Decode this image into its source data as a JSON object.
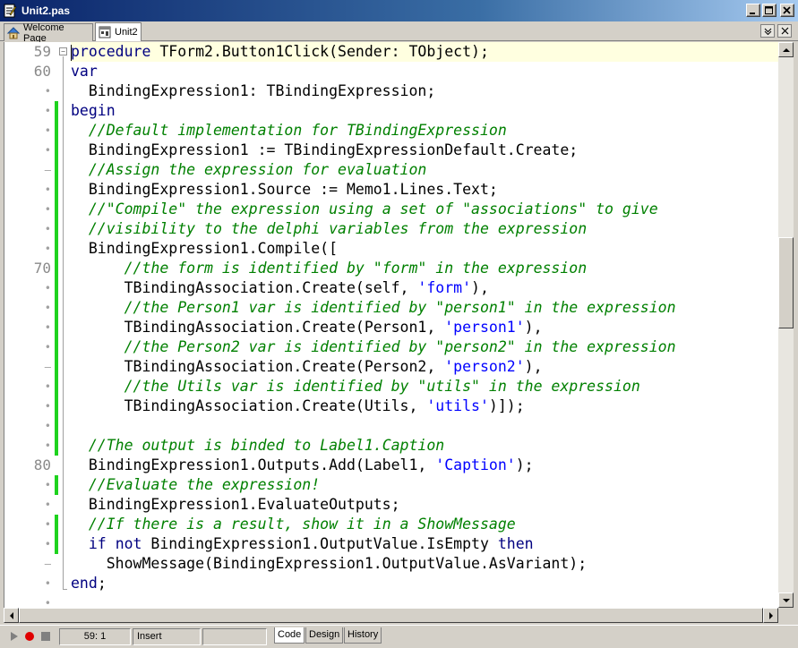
{
  "window": {
    "title": "Unit2.pas"
  },
  "tabs": [
    {
      "label": "Welcome Page"
    },
    {
      "label": "Unit2"
    }
  ],
  "gutter": [
    "59",
    "60",
    "•",
    "•",
    "•",
    "•",
    "–",
    "•",
    "•",
    "•",
    "•",
    "70",
    "•",
    "•",
    "•",
    "•",
    "–",
    "•",
    "•",
    "•",
    "•",
    "80",
    "•",
    "•",
    "•",
    "•",
    "–",
    "•",
    "•"
  ],
  "code": [
    "procedure TForm2.Button1Click(Sender: TObject);",
    "var",
    "  BindingExpression1: TBindingExpression;",
    "begin",
    "  //Default implementation for TBindingExpression",
    "  BindingExpression1 := TBindingExpressionDefault.Create;",
    "  //Assign the expression for evaluation",
    "  BindingExpression1.Source := Memo1.Lines.Text;",
    "  //\"Compile\" the expression using a set of \"associations\" to give",
    "  //visibility to the delphi variables from the expression",
    "  BindingExpression1.Compile([",
    "      //the form is identified by \"form\" in the expression",
    "      TBindingAssociation.Create(self, 'form'),",
    "      //the Person1 var is identified by \"person1\" in the expression",
    "      TBindingAssociation.Create(Person1, 'person1'),",
    "      //the Person2 var is identified by \"person2\" in the expression",
    "      TBindingAssociation.Create(Person2, 'person2'),",
    "      //the Utils var is identified by \"utils\" in the expression",
    "      TBindingAssociation.Create(Utils, 'utils')]);",
    "",
    "  //The output is binded to Label1.Caption",
    "  BindingExpression1.Outputs.Add(Label1, 'Caption');",
    "  //Evaluate the expression!",
    "  BindingExpression1.EvaluateOutputs;",
    "  //If there is a result, show it in a ShowMessage",
    "  if not BindingExpression1.OutputValue.IsEmpty then",
    "    ShowMessage(BindingExpression1.OutputValue.AsVariant);",
    "end;",
    ""
  ],
  "status": {
    "position": "59:  1",
    "mode": "Insert",
    "view_tabs": [
      "Code",
      "Design",
      "History"
    ]
  },
  "colors": {
    "keyword": "#000080",
    "comment": "#008000",
    "string": "#0000ff",
    "change_bar": "#1ed21e",
    "current_line": "#ffffe0"
  }
}
